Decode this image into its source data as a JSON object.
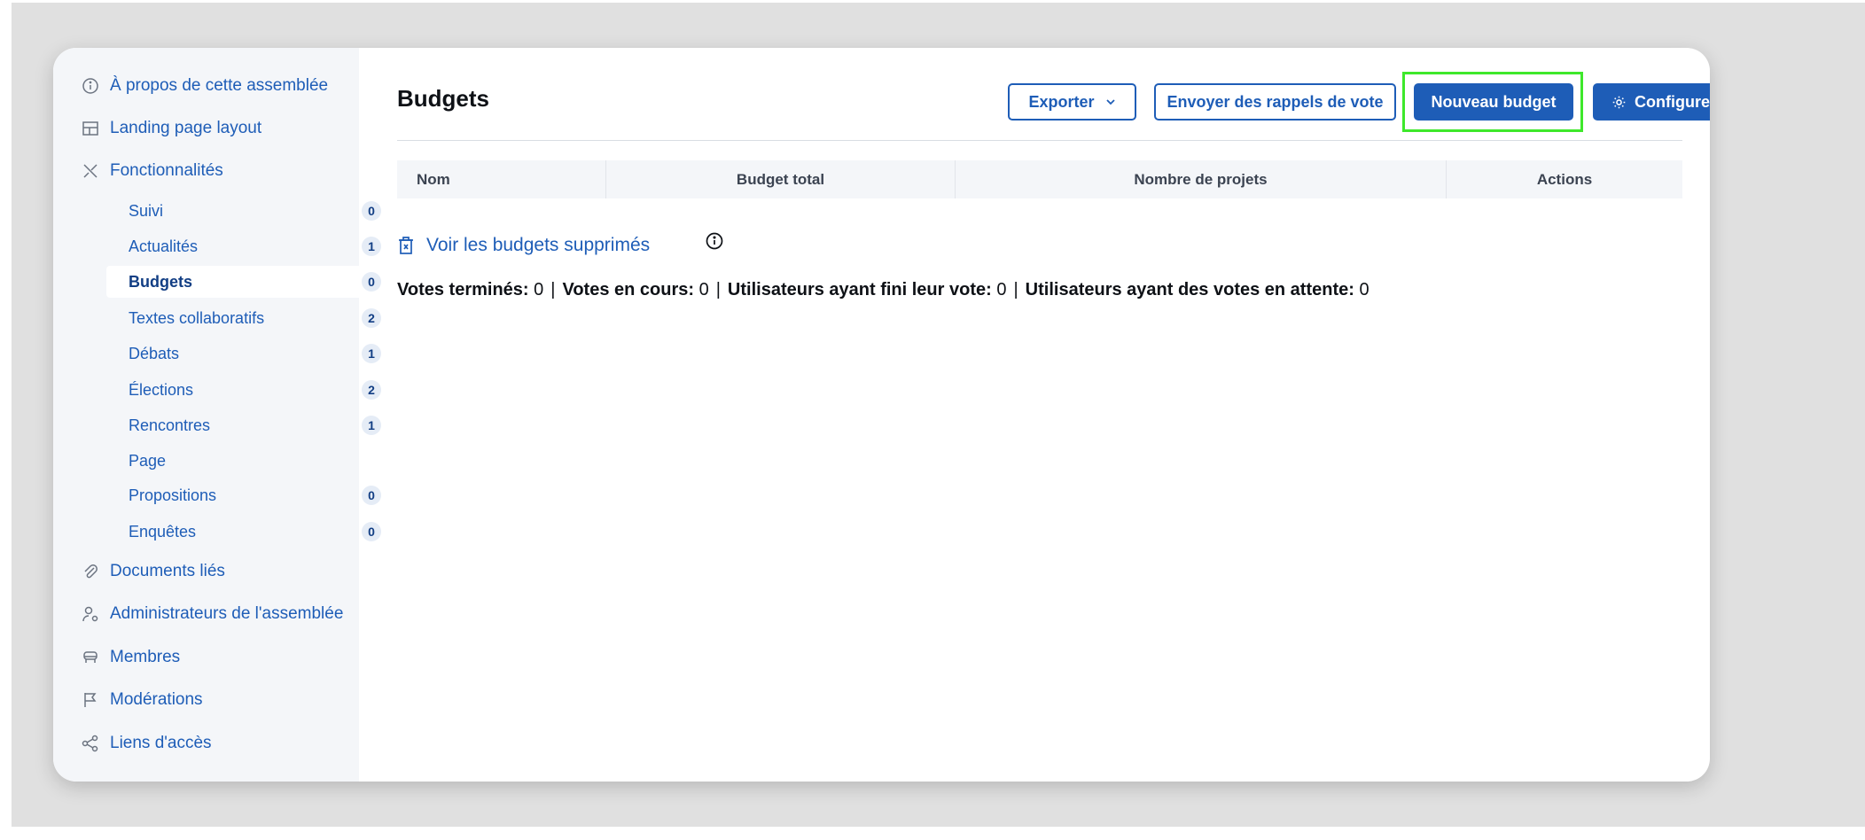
{
  "sidebar": {
    "items_top": [
      {
        "label": "À propos de cette assemblée",
        "icon": "info-icon"
      },
      {
        "label": "Landing page layout",
        "icon": "layout-icon"
      },
      {
        "label": "Fonctionnalités",
        "icon": "tools-icon"
      }
    ],
    "sub_items": [
      {
        "label": "Suivi",
        "count": "0"
      },
      {
        "label": "Actualités",
        "count": "1"
      },
      {
        "label": "Budgets",
        "count": "0",
        "active": true
      },
      {
        "label": "Textes collaboratifs",
        "count": "2"
      },
      {
        "label": "Débats",
        "count": "1"
      },
      {
        "label": "Élections",
        "count": "2"
      },
      {
        "label": "Rencontres",
        "count": "1"
      },
      {
        "label": "Page",
        "count": ""
      },
      {
        "label": "Propositions",
        "count": "0"
      },
      {
        "label": "Enquêtes",
        "count": "0"
      }
    ],
    "items_bottom": [
      {
        "label": "Documents liés",
        "icon": "paperclip-icon"
      },
      {
        "label": "Administrateurs de l'assemblée",
        "icon": "user-gear-icon"
      },
      {
        "label": "Membres",
        "icon": "members-icon"
      },
      {
        "label": "Modérations",
        "icon": "flag-icon"
      },
      {
        "label": "Liens d'accès",
        "icon": "share-icon"
      }
    ]
  },
  "header": {
    "title": "Budgets",
    "export_label": "Exporter",
    "reminders_label": "Envoyer des rappels de vote",
    "new_budget_label": "Nouveau budget",
    "configure_label": "Configurer"
  },
  "table": {
    "columns": [
      "Nom",
      "Budget total",
      "Nombre de projets",
      "Actions"
    ]
  },
  "deleted_link": "Voir les budgets supprimés",
  "stats": [
    {
      "label": "Votes terminés:",
      "value": "0"
    },
    {
      "label": "Votes en cours:",
      "value": "0"
    },
    {
      "label": "Utilisateurs ayant fini leur vote:",
      "value": "0"
    },
    {
      "label": "Utilisateurs ayant des votes en attente:",
      "value": "0"
    }
  ],
  "colors": {
    "accent": "#1e5db7",
    "highlight": "#3ee82b",
    "sidebar_bg": "#f4f6f9"
  }
}
